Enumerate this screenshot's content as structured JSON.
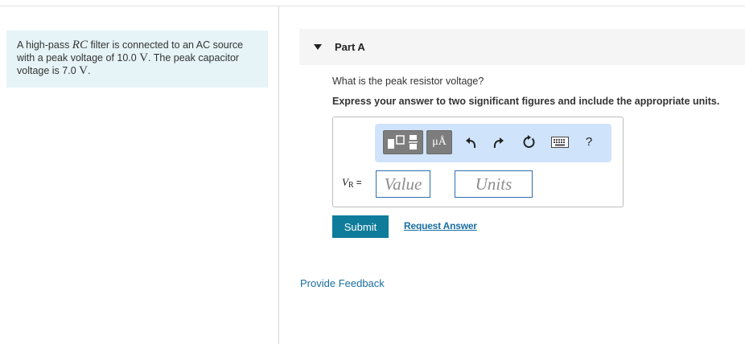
{
  "problem": {
    "text_before_rc": "A high-pass ",
    "rc": "RC",
    "text_line": " filter is connected to an AC source with a peak voltage of 10.0 ",
    "unit_v1": "V",
    "text_mid": ". The peak capacitor voltage is 7.0 ",
    "unit_v2": "V",
    "text_end": "."
  },
  "part": {
    "title": "Part A",
    "question": "What is the peak resistor voltage?",
    "instruction": "Express your answer to two significant figures and include the appropriate units."
  },
  "toolbar": {
    "units_label": "μÅ",
    "help_label": "?"
  },
  "answer": {
    "variable": "V",
    "subscript": "R",
    "equals": "=",
    "value_placeholder": "Value",
    "units_placeholder": "Units",
    "value": "",
    "units": ""
  },
  "actions": {
    "submit_label": "Submit",
    "request_answer_label": "Request Answer",
    "feedback_label": "Provide Feedback"
  },
  "colors": {
    "problem_bg": "#e6f4f7",
    "toolbar_bg": "#cfe3fa",
    "submit_bg": "#0e7c9a",
    "link": "#1a6ea0",
    "field_border": "#2b6fb0"
  },
  "icons": [
    "caret-down-icon",
    "templates-icon",
    "units-icon",
    "undo-icon",
    "redo-icon",
    "reset-icon",
    "keyboard-icon",
    "help-icon"
  ]
}
